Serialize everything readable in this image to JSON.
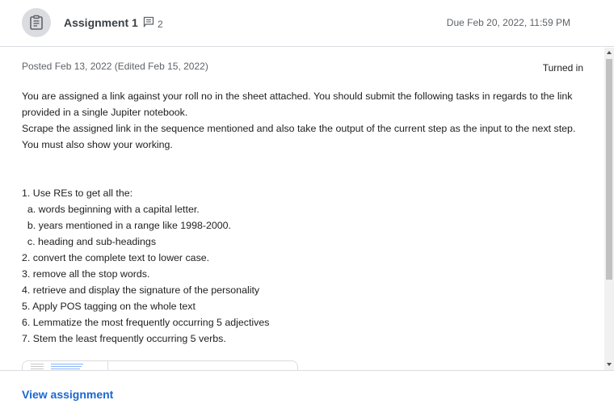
{
  "header": {
    "title": "Assignment 1",
    "comment_count": "2",
    "due": "Due Feb 20, 2022, 11:59 PM"
  },
  "meta": {
    "posted": "Posted Feb 13, 2022 (Edited Feb 15, 2022)",
    "status": "Turned in"
  },
  "description": {
    "paragraphs": [
      "You are assigned a link against your roll no in the sheet attached. You should submit the following tasks in regards to the link provided in a single Jupiter notebook.",
      "Scrape the assigned link in the sequence mentioned and also take the output of the current step as the input to the next step. You must also show your working."
    ],
    "tasks": [
      "1. Use REs to get all the:",
      "  a. words beginning with a capital letter.",
      "  b. years mentioned in a range like 1998-2000.",
      "  c. heading and sub-headings",
      "2. convert the complete text to lower case.",
      "3. remove all the stop words.",
      "4. retrieve and display the signature of the personality",
      "5. Apply POS tagging on the whole text",
      "6. Lemmatize the most frequently occurring 5 adjectives",
      "7. Stem the least frequently occurring 5 verbs."
    ]
  },
  "footer": {
    "view_label": "View assignment"
  },
  "icons": {
    "assignment": "assignment-icon",
    "comment": "comment-icon"
  },
  "colors": {
    "link": "#1967d2",
    "icon_bg": "#dadce0"
  }
}
